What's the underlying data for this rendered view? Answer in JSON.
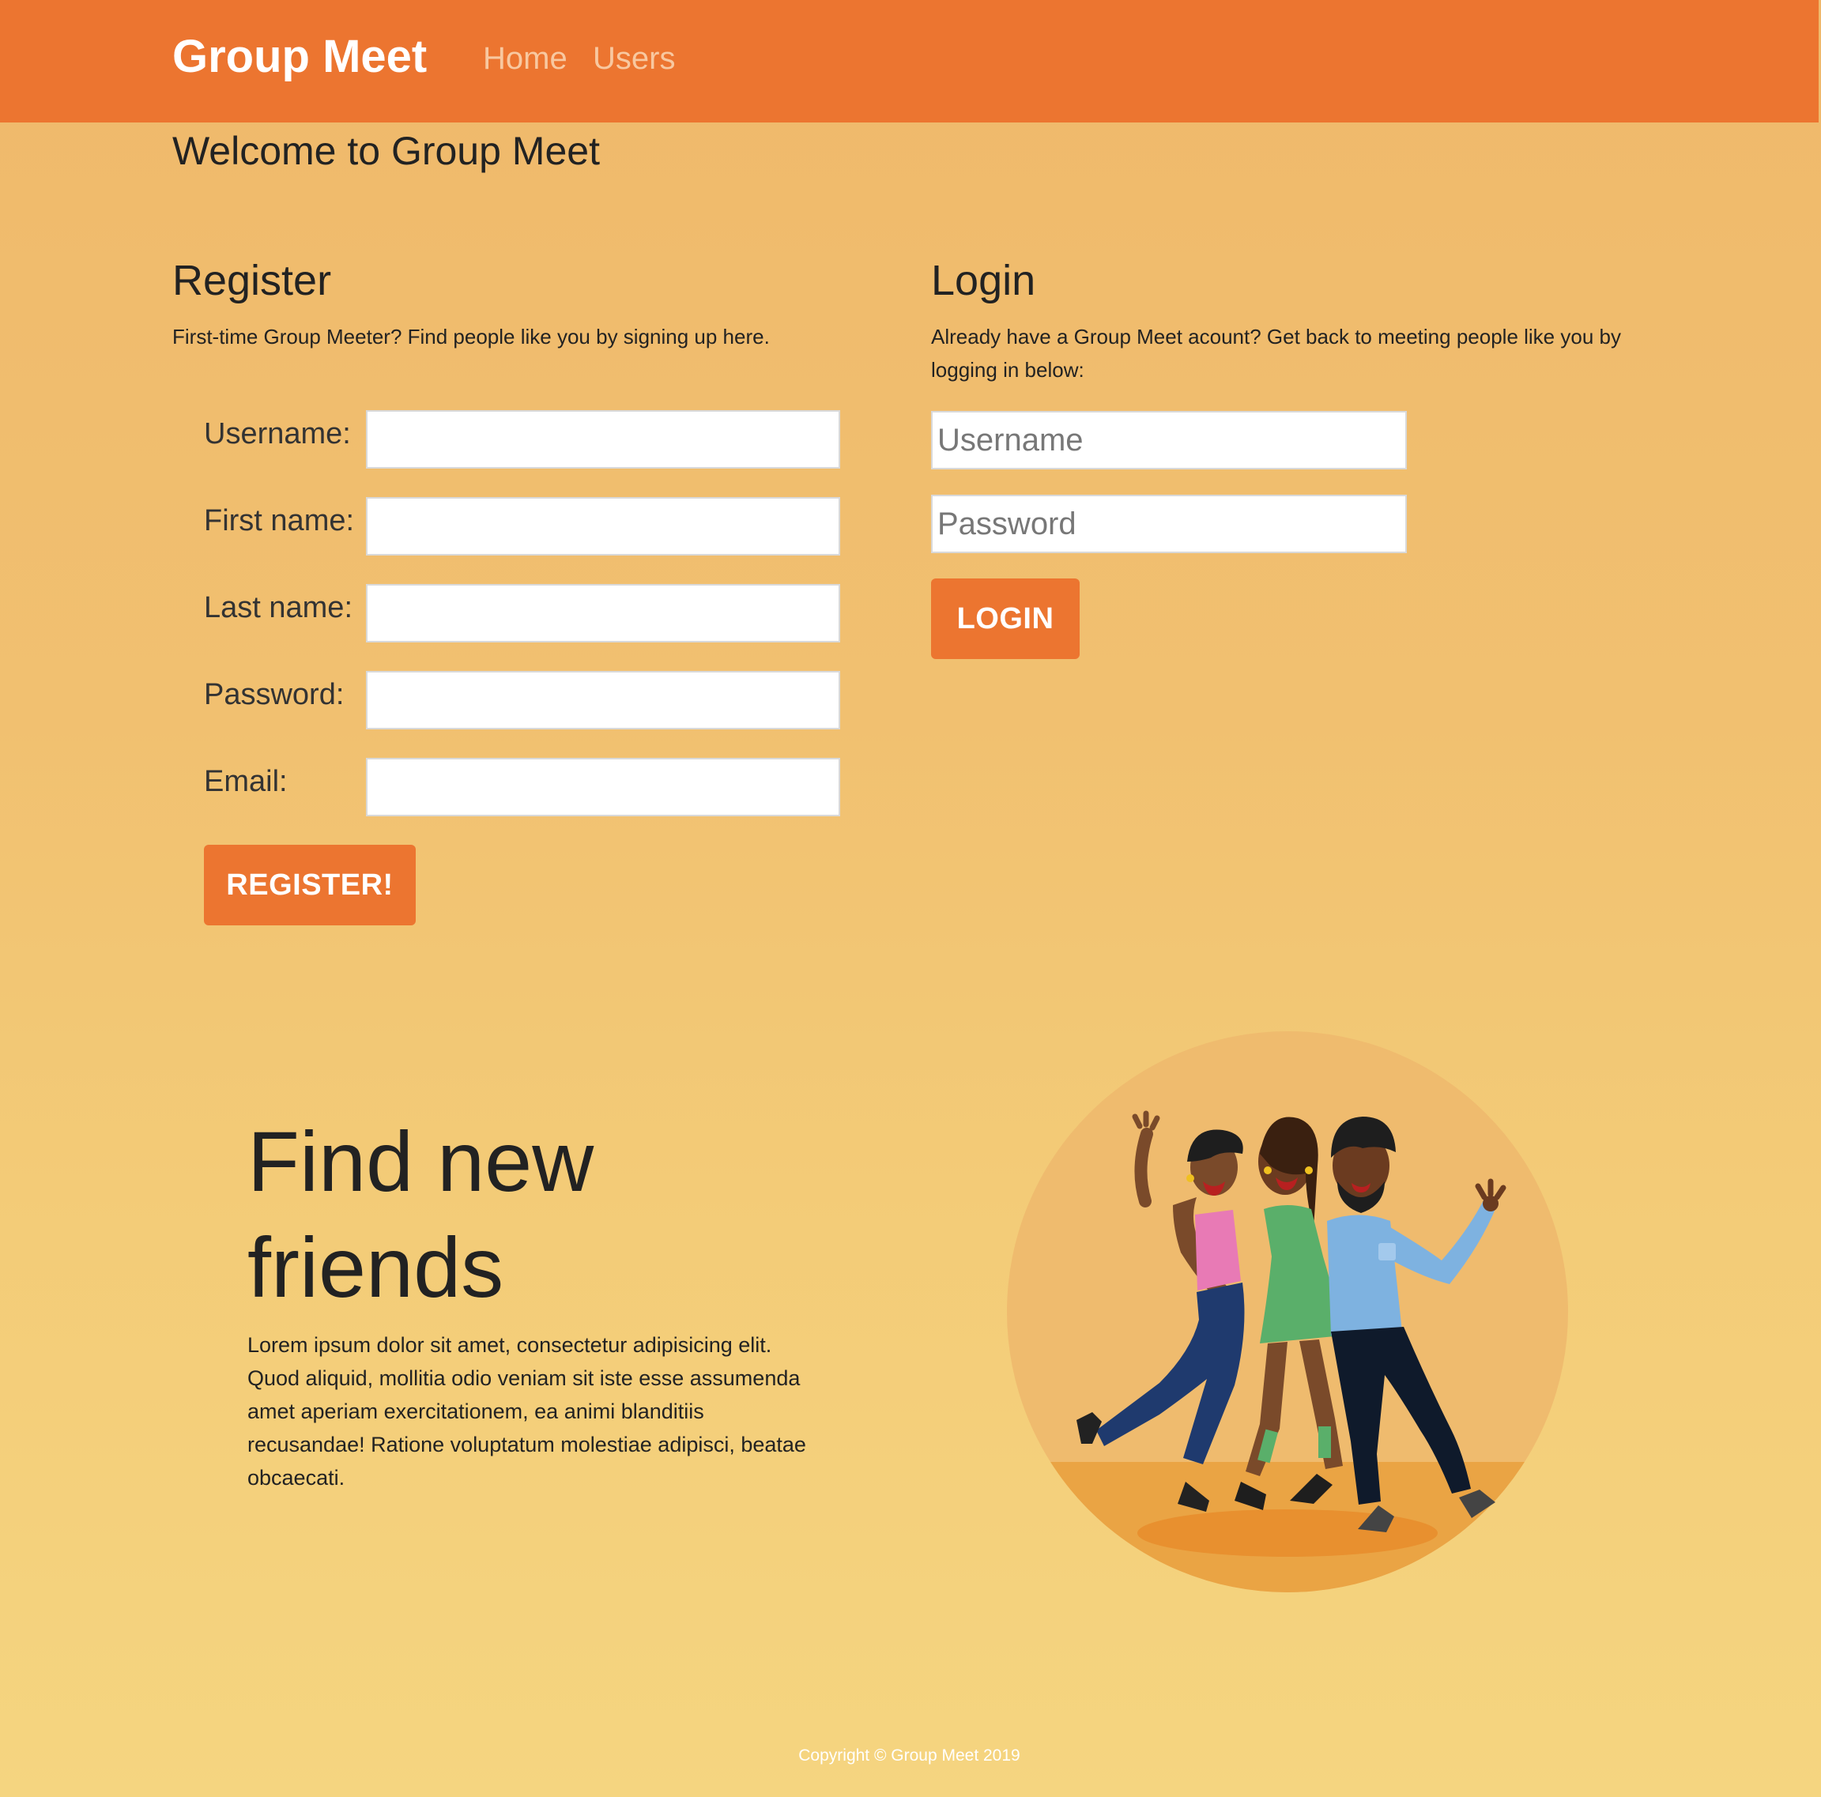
{
  "navbar": {
    "brand": "Group Meet",
    "links": [
      {
        "label": "Home"
      },
      {
        "label": "Users"
      }
    ]
  },
  "page": {
    "title": "Welcome to Group Meet"
  },
  "register": {
    "heading": "Register",
    "intro": "First-time Group Meeter? Find people like you by signing up here.",
    "fields": [
      {
        "label": "Username:",
        "value": ""
      },
      {
        "label": "First name:",
        "value": ""
      },
      {
        "label": "Last name:",
        "value": ""
      },
      {
        "label": "Password:",
        "value": ""
      },
      {
        "label": "Email:",
        "value": ""
      }
    ],
    "button_label": "REGISTER!"
  },
  "login": {
    "heading": "Login",
    "intro": "Already have a Group Meet acount? Get back to meeting people like you by logging in below:",
    "username_placeholder": "Username",
    "password_placeholder": "Password",
    "button_label": "LOGIN"
  },
  "hero": {
    "title": "Find new friends",
    "text": "Lorem ipsum dolor sit amet, consectetur adipisicing elit. Quod aliquid, mollitia odio veniam sit iste esse assumenda amet aperiam exercitationem, ea animi blanditiis recusandae! Ratione voluptatum molestiae adipisci, beatae obcaecati.",
    "illustration": "three-friends-dancing-illustration"
  },
  "footer": {
    "copyright": "Copyright © Group Meet 2019"
  },
  "colors": {
    "brand_orange": "#ec7530",
    "background_top": "#efb96b",
    "background_bottom": "#f5d580",
    "nav_link": "#f8c8a0"
  }
}
